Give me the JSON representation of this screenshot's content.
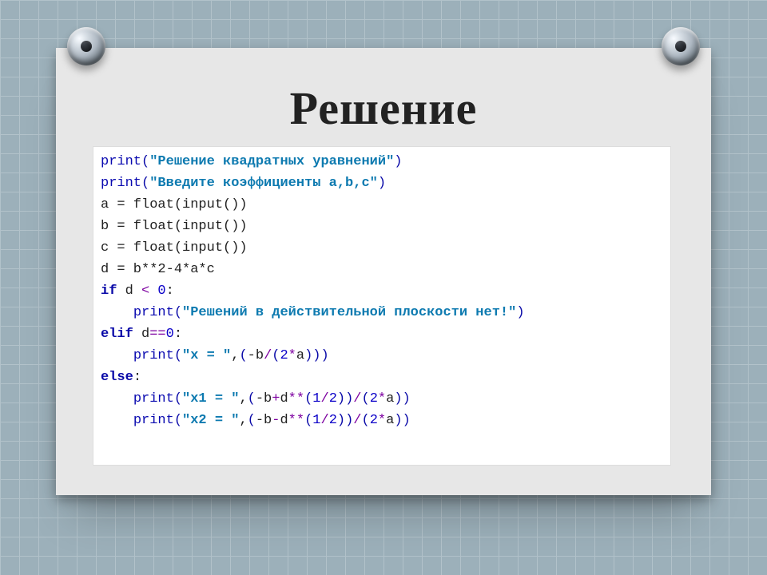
{
  "title": "Решение",
  "code": {
    "l1": [
      "print",
      "(",
      "\"Решение квадратных уравнений\"",
      ")"
    ],
    "l2": [
      "print",
      "(",
      "\"Введите коэффициенты a,b,c\"",
      ")"
    ],
    "l3": "a = float(input())",
    "l4": "b = float(input())",
    "l5": "c = float(input())",
    "l6": "d = b**2-4*a*c",
    "l7": [
      "if",
      " d ",
      "<",
      " ",
      "0",
      ":"
    ],
    "l8": [
      "    ",
      "print",
      "(",
      "\"Решений в действительной плоскости нет!\"",
      ")"
    ],
    "l9": [
      "elif",
      " d",
      "==",
      "0",
      ":"
    ],
    "l10": [
      "    ",
      "print",
      "(",
      "\"x = \"",
      ",",
      "(",
      "-b",
      "/",
      "(",
      "2",
      "*",
      "a",
      ")",
      ")",
      ")"
    ],
    "l11": [
      "else",
      ":"
    ],
    "l12": [
      "    ",
      "print",
      "(",
      "\"x1 = \"",
      ",",
      "(",
      "-b",
      "+",
      "d",
      "**",
      "(",
      "1",
      "/",
      "2",
      ")",
      ")",
      "/",
      "(",
      "2",
      "*",
      "a",
      ")",
      ")"
    ],
    "l13": [
      "    ",
      "print",
      "(",
      "\"x2 = \"",
      ",",
      "(",
      "-b",
      "-",
      "d",
      "**",
      "(",
      "1",
      "/",
      "2",
      ")",
      ")",
      "/",
      "(",
      "2",
      "*",
      "a",
      ")",
      ")"
    ]
  }
}
